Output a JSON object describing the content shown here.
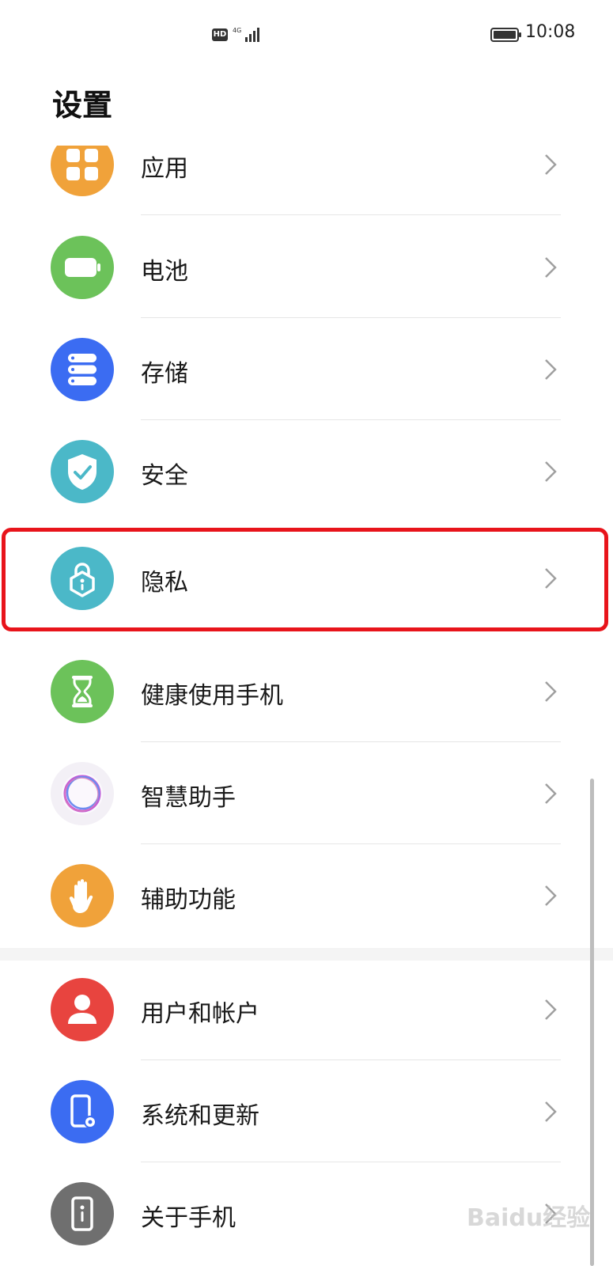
{
  "status_bar": {
    "hd": "HD",
    "time": "10:08"
  },
  "page_title": "设置",
  "items": [
    {
      "label": "应用",
      "icon": "apps-grid-icon",
      "color": "#f0a23a"
    },
    {
      "label": "电池",
      "icon": "battery-icon",
      "color": "#6cc25a"
    },
    {
      "label": "存储",
      "icon": "storage-icon",
      "color": "#3b6cf2"
    },
    {
      "label": "安全",
      "icon": "shield-check-icon",
      "color": "#4bb8c8"
    },
    {
      "label": "隐私",
      "icon": "privacy-lock-icon",
      "color": "#4bb8c8"
    },
    {
      "label": "健康使用手机",
      "icon": "hourglass-icon",
      "color": "#6cc25a"
    },
    {
      "label": "智慧助手",
      "icon": "assistant-ring-icon",
      "color": "#f3f0f6"
    },
    {
      "label": "辅助功能",
      "icon": "hand-icon",
      "color": "#f0a23a"
    },
    {
      "label": "用户和帐户",
      "icon": "user-icon",
      "color": "#e8443f"
    },
    {
      "label": "系统和更新",
      "icon": "phone-gear-icon",
      "color": "#3b6cf2"
    },
    {
      "label": "关于手机",
      "icon": "phone-info-icon",
      "color": "#6f6f6f"
    }
  ],
  "watermark": "Baidu经验"
}
